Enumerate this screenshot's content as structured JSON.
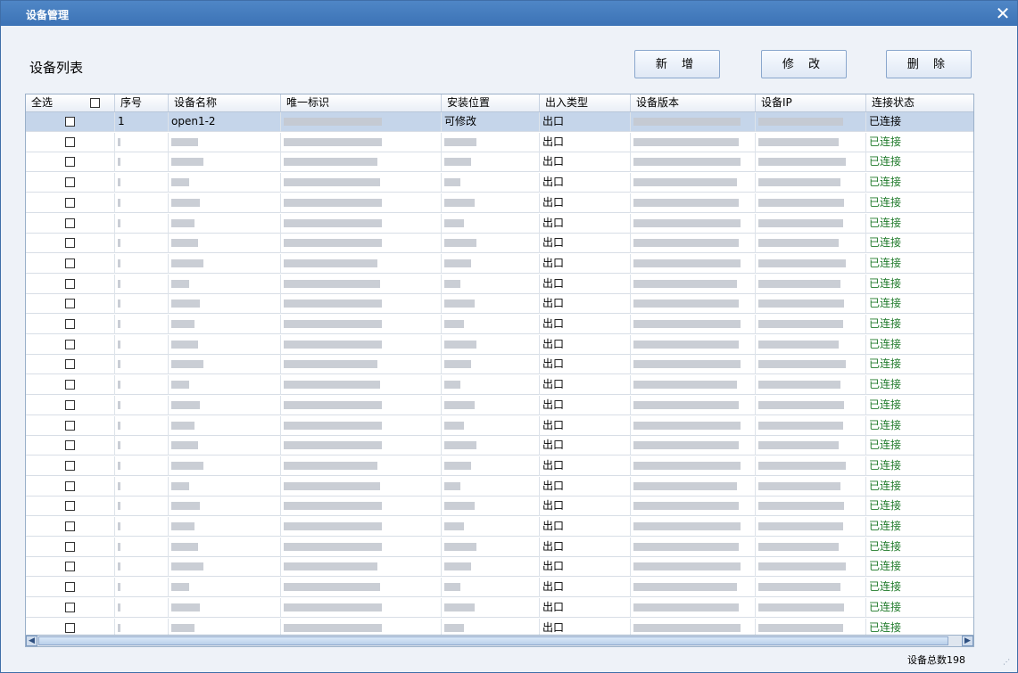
{
  "window": {
    "title": "设备管理"
  },
  "toolbar": {
    "list_title": "设备列表",
    "add_label": "新 增",
    "edit_label": "修 改",
    "delete_label": "删 除"
  },
  "table": {
    "columns": {
      "select_all": "全选",
      "seq": "序号",
      "name": "设备名称",
      "uid": "唯一标识",
      "location": "安装位置",
      "io_type": "出入类型",
      "version": "设备版本",
      "ip": "设备IP",
      "status": "连接状态"
    },
    "rows": [
      {
        "seq": "1",
        "name": "open1-2",
        "location": "可修改",
        "io_type": "出口",
        "status": "已连接"
      },
      {
        "io_type": "出口",
        "status": "已连接"
      },
      {
        "io_type": "出口",
        "status": "已连接"
      },
      {
        "io_type": "出口",
        "status": "已连接"
      },
      {
        "io_type": "出口",
        "status": "已连接"
      },
      {
        "io_type": "出口",
        "status": "已连接"
      },
      {
        "io_type": "出口",
        "status": "已连接"
      },
      {
        "io_type": "出口",
        "status": "已连接"
      },
      {
        "io_type": "出口",
        "status": "已连接"
      },
      {
        "io_type": "出口",
        "status": "已连接"
      },
      {
        "io_type": "出口",
        "status": "已连接"
      },
      {
        "io_type": "出口",
        "status": "已连接"
      },
      {
        "io_type": "出口",
        "status": "已连接"
      },
      {
        "io_type": "出口",
        "status": "已连接"
      },
      {
        "io_type": "出口",
        "status": "已连接"
      },
      {
        "io_type": "出口",
        "status": "已连接"
      },
      {
        "io_type": "出口",
        "status": "已连接"
      },
      {
        "io_type": "出口",
        "status": "已连接"
      },
      {
        "io_type": "出口",
        "status": "已连接"
      },
      {
        "io_type": "出口",
        "status": "已连接"
      },
      {
        "io_type": "出口",
        "status": "已连接"
      },
      {
        "io_type": "出口",
        "status": "已连接"
      },
      {
        "io_type": "出口",
        "status": "已连接"
      },
      {
        "io_type": "出口",
        "status": "已连接"
      },
      {
        "io_type": "出口",
        "status": "已连接"
      },
      {
        "io_type": "出口",
        "status": "已连接"
      }
    ]
  },
  "footer": {
    "total_label": "设备总数198"
  },
  "colors": {
    "title_bar": "#3c73b6",
    "status_connected": "#1f7a2a",
    "selected_row": "#c5d5ea"
  },
  "icons": {
    "close": "close-icon",
    "scroll_left": "arrow-left-icon",
    "scroll_right": "arrow-right-icon"
  }
}
